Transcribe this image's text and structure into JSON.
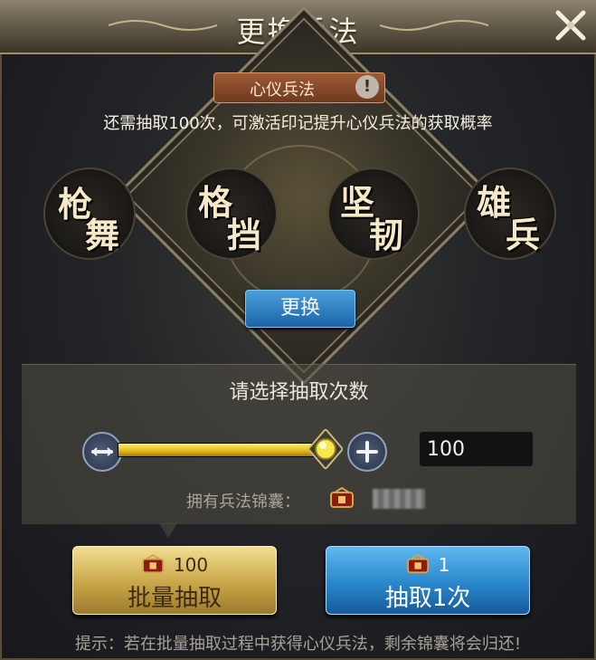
{
  "window": {
    "title": "更换兵法"
  },
  "mode": {
    "tag_label": "心仪兵法",
    "info_glyph": "!"
  },
  "hint": "还需抽取100次，可激活印记提升心仪兵法的获取概率",
  "tactics": [
    {
      "top": "枪",
      "bottom": "舞"
    },
    {
      "top": "格",
      "bottom": "挡"
    },
    {
      "top": "坚",
      "bottom": "韧"
    },
    {
      "top": "雄",
      "bottom": "兵"
    }
  ],
  "swap_button": "更换",
  "draw_panel": {
    "title": "请选择抽取次数",
    "slider_fraction": 1.0,
    "count_value": "100",
    "owned_label": "拥有兵法锦囊："
  },
  "batch_button": {
    "cost": "100",
    "label": "批量抽取"
  },
  "single_button": {
    "cost": "1",
    "label": "抽取1次"
  },
  "footer_tip": "提示：若在批量抽取过程中获得心仪兵法，剩余锦囊将会归还!",
  "colors": {
    "accent_gold": "#e0b318",
    "accent_blue": "#2a86cc",
    "tag_orange": "#9e5a35"
  },
  "icons": [
    "close-icon",
    "info-icon",
    "minus-icon",
    "plus-icon",
    "slider-thumb-icon",
    "silk-bag-icon"
  ]
}
